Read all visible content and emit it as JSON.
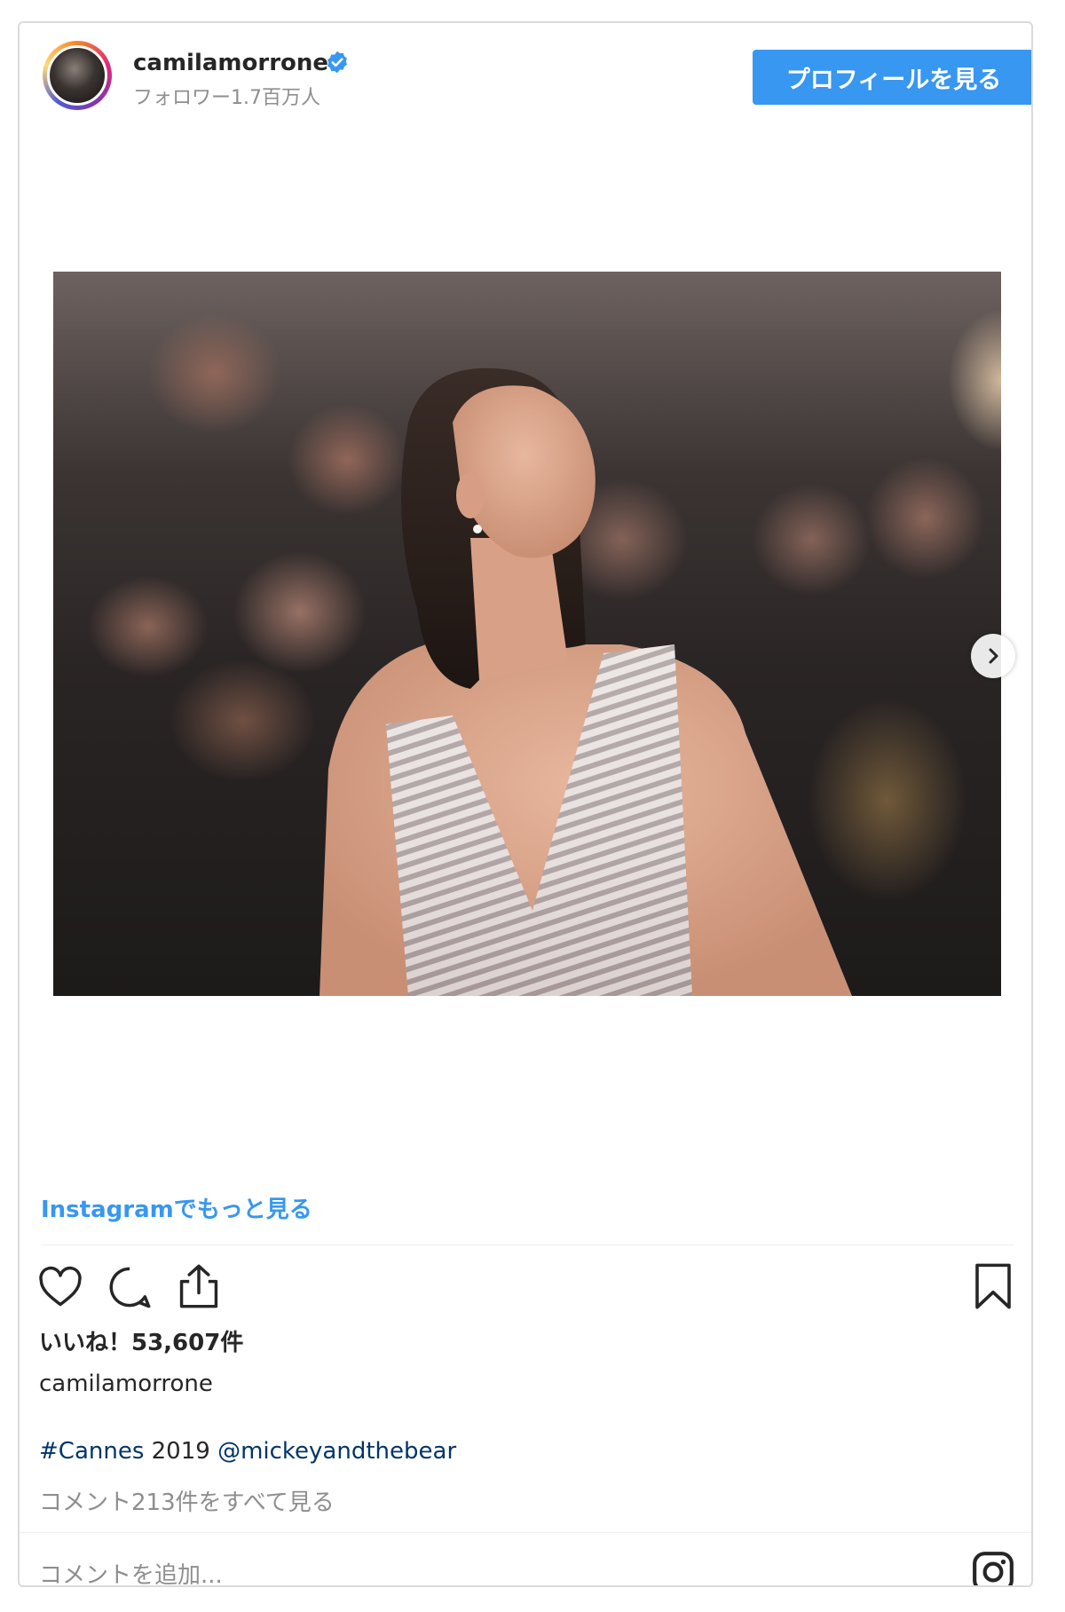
{
  "header": {
    "username": "camilamorrone",
    "followers": "フォロワー1.7百万人",
    "profile_button": "プロフィールを見る"
  },
  "post": {
    "more_link": "Instagramでもっと見る",
    "likes": "いいね！53,607件",
    "caption_user": "camilamorrone",
    "caption": {
      "hashtag": "#Cannes",
      "text": " 2019 ",
      "mention": "@mickeyandthebear"
    },
    "view_comments": "コメント213件をすべて見る",
    "comment_placeholder": "コメントを追加..."
  },
  "icons": {
    "verified": "verified-badge-icon",
    "next": "chevron-right-icon",
    "like": "heart-icon",
    "comment": "comment-bubble-icon",
    "share": "share-icon",
    "save": "bookmark-icon",
    "instagram": "instagram-logo-icon"
  },
  "colors": {
    "accent": "#3897f0",
    "link": "#003569",
    "muted": "#8e8e8e"
  }
}
